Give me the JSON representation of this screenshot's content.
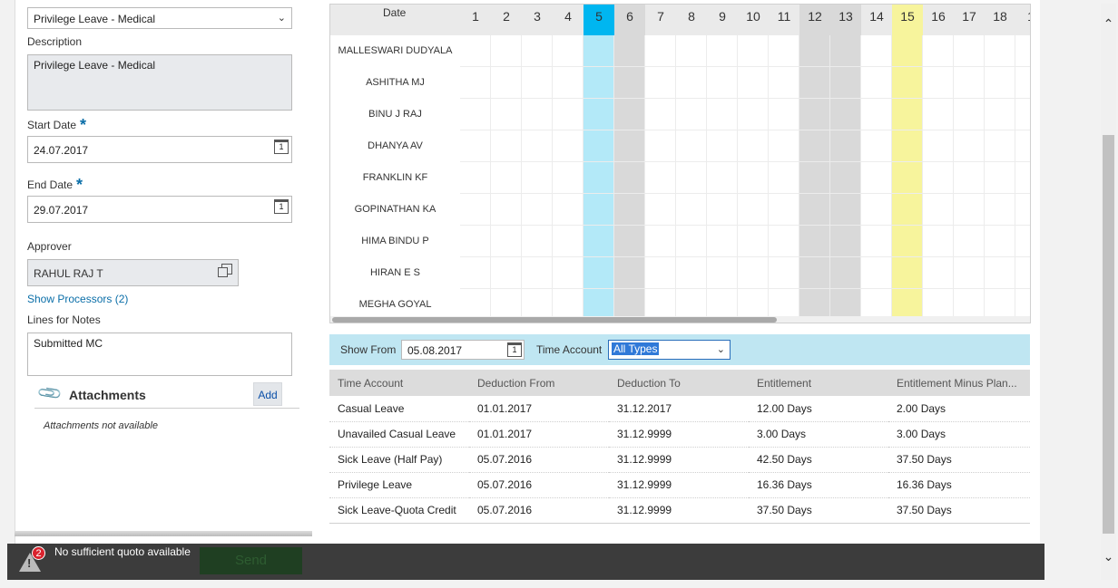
{
  "form": {
    "time_type": "Privilege Leave - Medical",
    "description_label": "Description",
    "description": "Privilege Leave - Medical",
    "start_date_label": "Start Date",
    "start_date": "24.07.2017",
    "end_date_label": "End Date",
    "end_date": "29.07.2017",
    "required_mark": "*",
    "calendar_glyph": "1",
    "approver_label": "Approver",
    "approver": "RAHUL RAJ T",
    "show_processors": "Show Processors (2)",
    "notes_label": "Lines for Notes",
    "notes": "Submitted MC"
  },
  "attachments": {
    "title": "Attachments",
    "add_label": "Add",
    "empty_text": "Attachments not available"
  },
  "calendar": {
    "date_label": "Date",
    "days": [
      "1",
      "2",
      "3",
      "4",
      "5",
      "6",
      "7",
      "8",
      "9",
      "10",
      "11",
      "12",
      "13",
      "14",
      "15",
      "16",
      "17",
      "18",
      "1"
    ],
    "today_day": "5",
    "weekend_days": [
      "6",
      "12",
      "13"
    ],
    "highlight_day": "15",
    "employees": [
      "MALLESWARI DUDYALA",
      "ASHITHA MJ",
      "BINU J RAJ",
      "DHANYA AV",
      "FRANKLIN KF",
      "GOPINATHAN KA",
      "HIMA BINDU P",
      "HIRAN E S",
      "MEGHA GOYAL"
    ],
    "colors": {
      "today": "#00b6f0",
      "today_col": "#b3e9f8",
      "weekend": "#d9d9d9",
      "highlight": "#f7f49c"
    }
  },
  "filter": {
    "show_from_label": "Show From",
    "show_from": "05.08.2017",
    "time_account_label": "Time Account",
    "time_account": "All Types"
  },
  "quota_table": {
    "columns": [
      "Time Account",
      "Deduction From",
      "Deduction To",
      "Entitlement",
      "Entitlement Minus Plan..."
    ],
    "rows": [
      [
        "Casual Leave",
        "01.01.2017",
        "31.12.2017",
        "12.00 Days",
        "2.00 Days"
      ],
      [
        "Unavailed Casual Leave",
        "01.01.2017",
        "31.12.9999",
        "3.00 Days",
        "3.00 Days"
      ],
      [
        "Sick Leave (Half Pay)",
        "05.07.2016",
        "31.12.9999",
        "42.50 Days",
        "37.50 Days"
      ],
      [
        "Privilege Leave",
        "05.07.2016",
        "31.12.9999",
        "16.36 Days",
        "16.36 Days"
      ],
      [
        "Sick Leave-Quota Credit",
        "05.07.2016",
        "31.12.9999",
        "37.50 Days",
        "37.50 Days"
      ]
    ]
  },
  "toast": {
    "count": "2",
    "message": "No sufficient quoto available",
    "send_label": "Send"
  }
}
